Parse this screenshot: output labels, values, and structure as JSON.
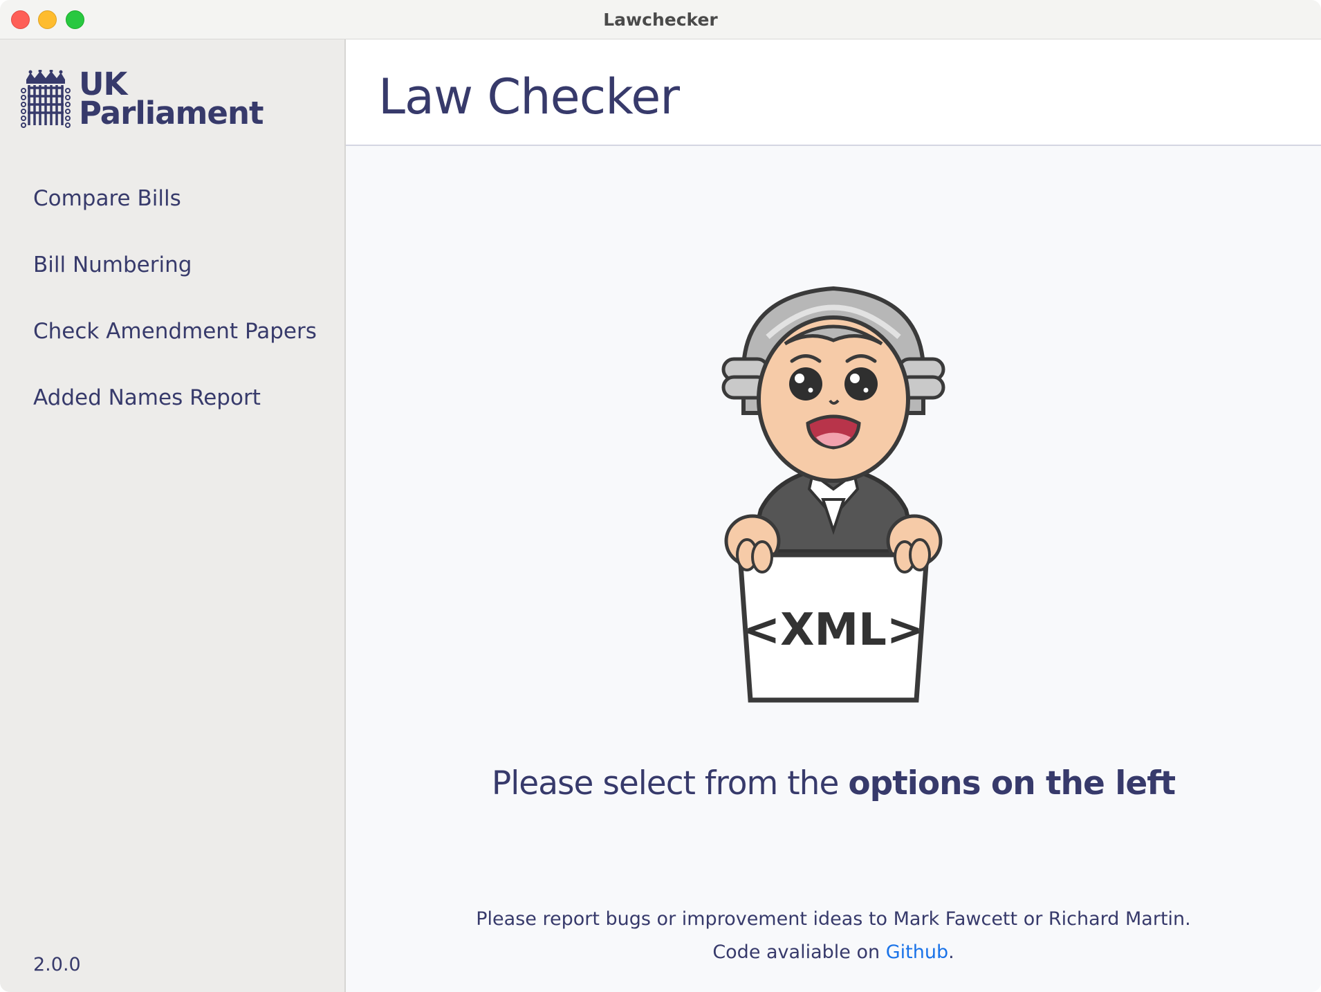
{
  "window": {
    "title": "Lawchecker"
  },
  "sidebar": {
    "logo": {
      "line1": "UK",
      "line2": "Parliament"
    },
    "items": [
      {
        "label": "Compare Bills"
      },
      {
        "label": "Bill Numbering"
      },
      {
        "label": "Check Amendment Papers"
      },
      {
        "label": "Added Names Report"
      }
    ],
    "version": "2.0.0"
  },
  "main": {
    "title": "Law Checker",
    "mascot": {
      "sign_text": "<XML>"
    },
    "prompt": {
      "regular": "Please select from the",
      "bold": "options on the left"
    },
    "footer": {
      "line1": "Please report bugs or improvement ideas to Mark Fawcett or Richard Martin.",
      "line2_prefix": "Code avaliable on",
      "link_label": "Github",
      "line2_suffix": "."
    }
  },
  "colors": {
    "primary_text": "#373a6b",
    "link": "#1a73e8",
    "sidebar_bg": "#edecea",
    "content_bg": "#f8f9fb"
  },
  "icons": [
    "portcullis-logo-icon",
    "judge-mascot-illustration"
  ]
}
